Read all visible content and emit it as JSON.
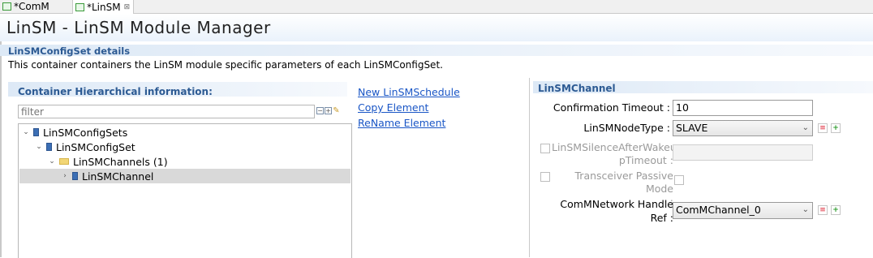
{
  "tabs": [
    {
      "label": "*ComM"
    },
    {
      "label": "*LinSM",
      "close": "⊠"
    }
  ],
  "title": "LinSM - LinSM Module Manager",
  "section": {
    "heading": "LinSMConfigSet details",
    "description": "This container containers the LinSM module specific parameters of each LinSMConfigSet."
  },
  "left": {
    "heading": "Container Hierarchical information:",
    "filter_placeholder": "filter",
    "tree": [
      {
        "label": "LinSMConfigSets",
        "arrow": "⌄"
      },
      {
        "label": "LinSMConfigSet",
        "arrow": "⌄"
      },
      {
        "label": "LinSMChannels (1)",
        "arrow": "⌄"
      },
      {
        "label": "LinSMChannel",
        "arrow": "›"
      }
    ]
  },
  "actions": {
    "new_schedule": "New LinSMSchedule",
    "copy": "Copy Element",
    "rename": "ReName Element"
  },
  "right": {
    "heading": "LinSMChannel",
    "confirmation_timeout_label": "Confirmation Timeout :",
    "confirmation_timeout_value": "10",
    "node_type_label": "LinSMNodeType :",
    "node_type_value": "SLAVE",
    "silence_label_1": "LinSMSilenceAfterWakeu",
    "silence_label_2": "pTimeout :",
    "transceiver_label_1": "Transceiver Passive Mode",
    "transceiver_label_2": ":",
    "comm_label_1": "ComMNetwork Handle",
    "comm_label_2": "Ref :",
    "comm_value": "ComMChannel_0"
  }
}
